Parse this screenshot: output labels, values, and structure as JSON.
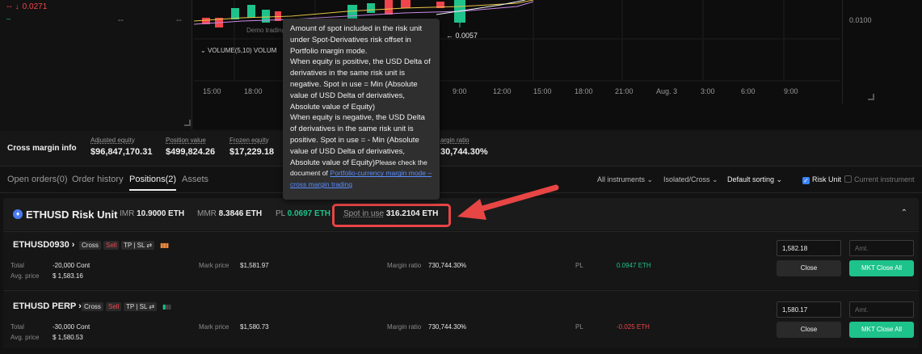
{
  "ticker": {
    "change": "-- ",
    "change_pct": "0.0271",
    "dash1": "--",
    "dash2": "--"
  },
  "chart": {
    "price_label": "0.0100",
    "demo_label": "Demo trading",
    "volume_label": "VOLUME(5,10)  VOLUM",
    "last_price": "← 0.0057",
    "time_ticks": [
      "15:00",
      "18:00",
      "9:00",
      "12:00",
      "15:00",
      "18:00",
      "21:00",
      "Aug. 3",
      "3:00",
      "6:00",
      "9:00"
    ]
  },
  "margin_info": {
    "title": "Cross margin info",
    "items": [
      {
        "label": "Adjusted equity",
        "value": "$96,847,170.31"
      },
      {
        "label": "Position value",
        "value": "$499,824.26"
      },
      {
        "label": "Frozen equity",
        "value": "$17,229.18"
      },
      {
        "label": "argin ratio",
        "value": "30,744.30%"
      }
    ]
  },
  "tabs": {
    "open_orders": "Open orders(0)",
    "order_history": "Order history",
    "positions": "Positions(2)",
    "assets": "Assets",
    "all_instruments": "All instruments",
    "isolated_cross": "Isolated/Cross",
    "default_sorting": "Default sorting",
    "risk_unit": "Risk Unit",
    "current_instrument": "Current instrument"
  },
  "risk_unit": {
    "title": "ETHUSD Risk Unit",
    "imr_label": "IMR",
    "imr_value": "10.9000 ETH",
    "mmr_label": "MMR",
    "mmr_value": "8.3846 ETH",
    "pl_label": "PL",
    "pl_value": "0.0697 ETH",
    "spot_label": "Spot in use",
    "spot_value": "316.2104 ETH"
  },
  "positions": [
    {
      "name": "ETHUSD0930",
      "mode": "Cross",
      "side": "Sell",
      "tpsl": "TP | SL",
      "total_label": "Total",
      "total": "-20,000 Cont",
      "avg_label": "Avg. price",
      "avg": "$ 1,583.16",
      "mark_label": "Mark price",
      "mark": "$1,581.97",
      "mr_label": "Margin ratio",
      "mr": "730,744.30%",
      "pl_label": "PL",
      "pl": "0.0947 ETH",
      "price_input": "1,582.18",
      "amt_placeholder": "Amt.",
      "close": "Close",
      "mkt_close": "MKT Close All"
    },
    {
      "name": "ETHUSD PERP",
      "mode": "Cross",
      "side": "Sell",
      "tpsl": "TP | SL",
      "total_label": "Total",
      "total": "-30,000 Cont",
      "avg_label": "Avg. price",
      "avg": "$ 1,580.53",
      "mark_label": "Mark price",
      "mark": "$1,580.73",
      "mr_label": "Margin ratio",
      "mr": "730,744.30%",
      "pl_label": "PL",
      "pl": "-0.025 ETH",
      "price_input": "1,580.17",
      "amt_placeholder": "Amt.",
      "close": "Close",
      "mkt_close": "MKT Close All"
    }
  ],
  "tooltip": {
    "p1": "Amount of spot included in the risk unit under Spot-Derivatives risk offset in Portfolio margin mode.",
    "p2": "When equity is positive, the USD Delta of derivatives in the same risk unit is negative. Spot in use = Min (Absolute value of USD Delta of derivatives, Absolute value of Equity)",
    "p3": "When equity is negative, the USD Delta of derivatives in the same risk unit is positive. Spot in use = - Min (Absolute value of USD Delta of derivatives, Absolute value of Equity)",
    "p4": "Please check the document of",
    "link": "Portfolio-currency margin mode – cross margin trading"
  },
  "colors": {
    "green": "#1ec28b",
    "red": "#f0454c",
    "annotation": "#e84545",
    "accent_blue": "#3b82f6"
  }
}
